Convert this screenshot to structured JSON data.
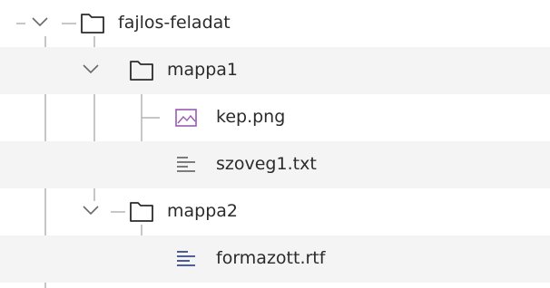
{
  "tree": {
    "root": {
      "label": "fajlos-feladat",
      "icon": "folder-icon",
      "expanded": true
    },
    "folders": [
      {
        "label": "mappa1",
        "icon": "folder-icon",
        "expanded": true,
        "files": [
          {
            "label": "kep.png",
            "icon": "image-file-icon"
          },
          {
            "label": "szoveg1.txt",
            "icon": "text-file-icon"
          }
        ]
      },
      {
        "label": "mappa2",
        "icon": "folder-icon",
        "expanded": true,
        "files": [
          {
            "label": "formazott.rtf",
            "icon": "rich-text-file-icon"
          }
        ]
      }
    ]
  },
  "colors": {
    "row_alt": "#f4f4f4",
    "tree_line": "#b4b4b4",
    "icon_stroke": "#2b2b2b",
    "image_icon": "#9b59b6",
    "rtf_icon_lines": "#3a4a8c"
  }
}
